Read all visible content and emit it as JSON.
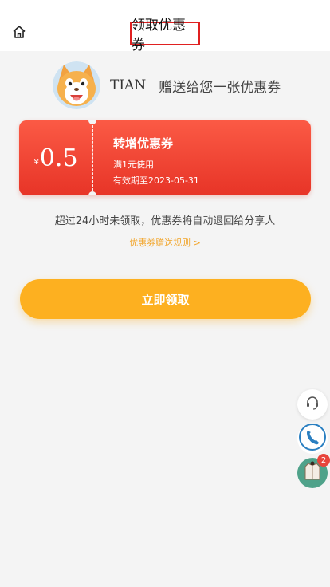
{
  "header": {
    "title": "领取优惠券",
    "home_icon": "home-icon"
  },
  "giver": {
    "name": "TIAN",
    "message": "赠送给您一张优惠券",
    "avatar_icon": "cartoon-dog-avatar"
  },
  "coupon": {
    "currency": "¥",
    "value": "0.5",
    "title": "转增优惠券",
    "condition": "满1元使用",
    "expiry": "有效期至2023-05-31",
    "colors": {
      "top": "#fb5a45",
      "bottom": "#e73427"
    }
  },
  "notice": "超过24小时未领取，优惠券将自动退回给分享人",
  "rules_link": "优惠券赠送规则 >",
  "claim_button": "立即领取",
  "floating": {
    "service_icon": "headset-icon",
    "phone_icon": "phone-icon",
    "cart_icon": "shopping-clothes-icon",
    "cart_badge": "2"
  },
  "colors": {
    "accent": "#fdb020",
    "link": "#f2a52a",
    "title_border": "#e02020",
    "badge": "#e8453c"
  }
}
